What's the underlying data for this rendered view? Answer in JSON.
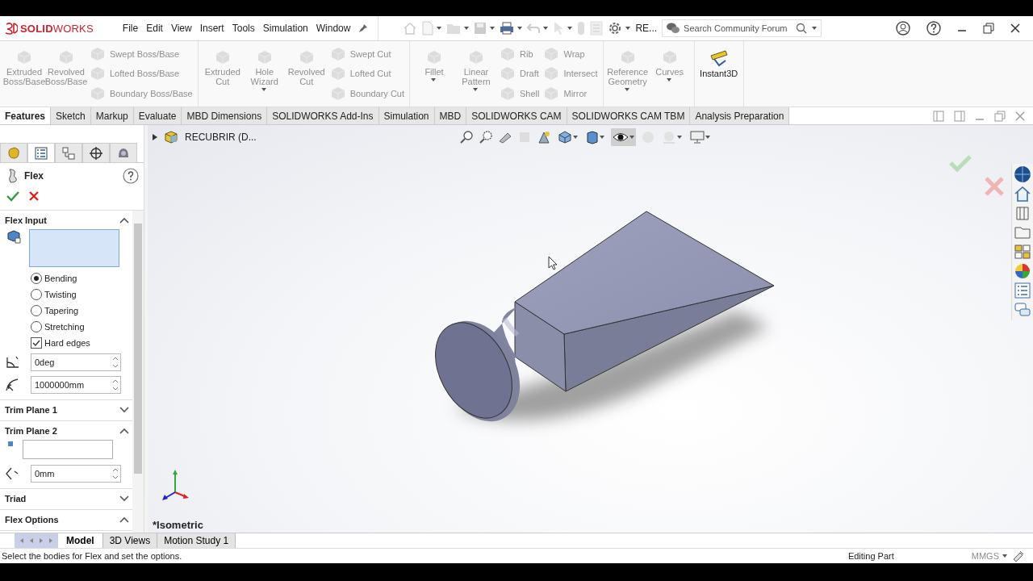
{
  "app": {
    "logo": "**SOLID**WORKS"
  },
  "menu": [
    "File",
    "Edit",
    "View",
    "Insert",
    "Tools",
    "Simulation",
    "Window"
  ],
  "quick_access": {
    "overflow_label": "RE..."
  },
  "search": {
    "placeholder": "Search Community Forum"
  },
  "ribbon": {
    "groups": [
      {
        "columns": [
          {
            "kind": "large",
            "label": "Extruded Boss/Base",
            "disabled": true
          },
          {
            "kind": "large",
            "label": "Revolved Boss/Base",
            "disabled": true
          },
          {
            "kind": "stack",
            "items": [
              {
                "label": "Swept Boss/Base",
                "disabled": true
              },
              {
                "label": "Lofted Boss/Base",
                "disabled": true
              },
              {
                "label": "Boundary Boss/Base",
                "disabled": true
              }
            ]
          }
        ]
      },
      {
        "columns": [
          {
            "kind": "large",
            "label": "Extruded Cut",
            "disabled": true
          },
          {
            "kind": "large",
            "label": "Hole Wizard",
            "disabled": true,
            "dropdown": true
          },
          {
            "kind": "large",
            "label": "Revolved Cut",
            "disabled": true
          },
          {
            "kind": "stack",
            "items": [
              {
                "label": "Swept Cut",
                "disabled": true
              },
              {
                "label": "Lofted Cut",
                "disabled": true
              },
              {
                "label": "Boundary Cut",
                "disabled": true
              }
            ]
          }
        ]
      },
      {
        "columns": [
          {
            "kind": "large",
            "label": "Fillet",
            "disabled": true,
            "dropdown": true
          },
          {
            "kind": "large",
            "label": "Linear Pattern",
            "disabled": true,
            "dropdown": true
          },
          {
            "kind": "stack",
            "items": [
              {
                "label": "Rib",
                "disabled": true
              },
              {
                "label": "Draft",
                "disabled": true
              },
              {
                "label": "Shell",
                "disabled": true
              }
            ]
          },
          {
            "kind": "stack",
            "items": [
              {
                "label": "Wrap",
                "disabled": true
              },
              {
                "label": "Intersect",
                "disabled": true
              },
              {
                "label": "Mirror",
                "disabled": true
              }
            ]
          }
        ]
      },
      {
        "columns": [
          {
            "kind": "large",
            "label": "Reference Geometry",
            "disabled": true,
            "dropdown": true
          },
          {
            "kind": "large",
            "label": "Curves",
            "disabled": true,
            "dropdown": true
          }
        ]
      },
      {
        "columns": [
          {
            "kind": "large",
            "label": "Instant3D",
            "disabled": false
          }
        ]
      }
    ]
  },
  "command_tabs": [
    {
      "label": "Features",
      "selected": true
    },
    {
      "label": "Sketch",
      "selected": false
    },
    {
      "label": "Markup",
      "selected": false
    },
    {
      "label": "Evaluate",
      "selected": false
    },
    {
      "label": "MBD Dimensions",
      "selected": false
    },
    {
      "label": "SOLIDWORKS Add-Ins",
      "selected": false
    },
    {
      "label": "Simulation",
      "selected": false
    },
    {
      "label": "MBD",
      "selected": false
    },
    {
      "label": "SOLIDWORKS CAM",
      "selected": false
    },
    {
      "label": "SOLIDWORKS CAM TBM",
      "selected": false
    },
    {
      "label": "Analysis Preparation",
      "selected": false
    }
  ],
  "feature_tree": {
    "part_name": "RECUBRIR  (D..."
  },
  "property_manager": {
    "tabs": [
      {
        "selected": false
      },
      {
        "selected": true
      },
      {
        "selected": false
      },
      {
        "selected": false
      },
      {
        "selected": false
      }
    ],
    "title": "Flex",
    "sections": [
      {
        "title": "Flex Input",
        "expanded": true,
        "selection": {
          "kind": "bodies",
          "active": true
        },
        "options": [
          {
            "label": "Bending",
            "selected": true
          },
          {
            "label": "Twisting",
            "selected": false
          },
          {
            "label": "Tapering",
            "selected": false
          },
          {
            "label": "Stretching",
            "selected": false
          }
        ],
        "checkbox": {
          "label": "Hard edges",
          "checked": true
        },
        "fields": [
          {
            "kind": "angle",
            "value": "0deg"
          },
          {
            "kind": "radius",
            "value": "1000000mm"
          }
        ]
      },
      {
        "title": "Trim Plane 1",
        "expanded": false
      },
      {
        "title": "Trim Plane 2",
        "expanded": true,
        "selection": {
          "kind": "plane",
          "active": false
        },
        "fields": [
          {
            "kind": "offset",
            "value": "0mm"
          }
        ]
      },
      {
        "title": "Triad",
        "expanded": false
      },
      {
        "title": "Flex Options",
        "expanded": true
      }
    ]
  },
  "view": {
    "orientation_label": "*Isometric"
  },
  "model_tabs": [
    {
      "label": "Model",
      "selected": true
    },
    {
      "label": "3D Views",
      "selected": false
    },
    {
      "label": "Motion Study 1",
      "selected": false
    }
  ],
  "status_bar": {
    "message": "Select the bodies for Flex and set the options.",
    "mode": "Editing Part",
    "units": "MMGS"
  }
}
